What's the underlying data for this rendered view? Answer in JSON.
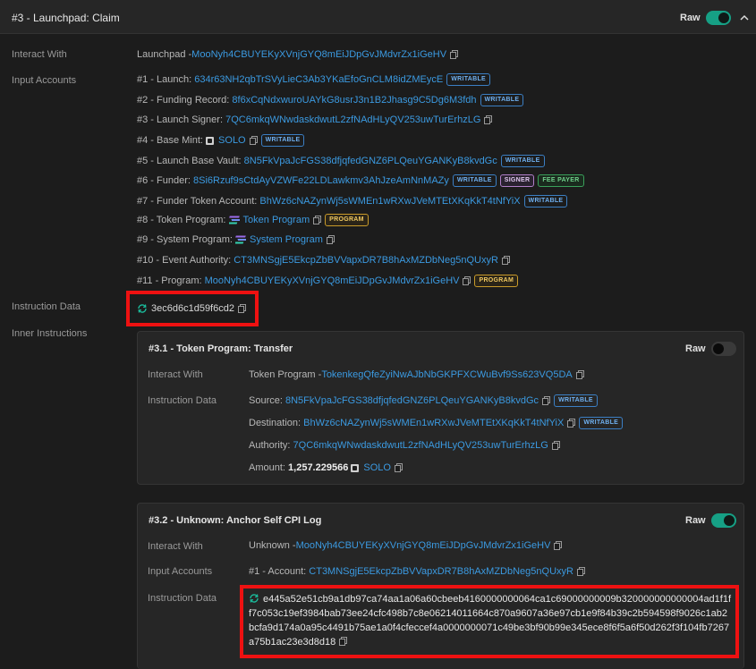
{
  "header": {
    "title": "#3 - Launchpad: Claim",
    "raw_label": "Raw"
  },
  "labels": {
    "interact_with": "Interact With",
    "input_accounts": "Input Accounts",
    "instruction_data": "Instruction Data",
    "inner_instructions": "Inner Instructions"
  },
  "interact": {
    "prefix": "Launchpad - ",
    "address": "MooNyh4CBUYEKyXVnjGYQ8mEiJDpGvJMdvrZx1iGeHV"
  },
  "accounts": [
    {
      "label": "#1 - Launch:",
      "value": "634r63NH2qbTrSVyLieC3Ab3YKaEfoGnCLM8idZMEycE",
      "badges": [
        "WRITABLE"
      ]
    },
    {
      "label": "#2 - Funding Record:",
      "value": "8f6xCqNdxwuroUAYkG8usrJ3n1B2Jhasg9C5Dg6M3fdh",
      "badges": [
        "WRITABLE"
      ]
    },
    {
      "label": "#3 - Launch Signer:",
      "value": "7QC6mkqWNwdaskdwutL2zfNAdHLyQV253uwTurErhzLG",
      "badges": []
    },
    {
      "label": "#4 - Base Mint:",
      "value": "SOLO",
      "badges": [
        "WRITABLE"
      ]
    },
    {
      "label": "#5 - Launch Base Vault:",
      "value": "8N5FkVpaJcFGS38dfjqfedGNZ6PLQeuYGANKyB8kvdGc",
      "badges": [
        "WRITABLE"
      ]
    },
    {
      "label": "#6 - Funder:",
      "value": "8Si6Rzuf9sCtdAyVZWFe22LDLawkmv3AhJzeAmNnMAZy",
      "badges": [
        "WRITABLE",
        "SIGNER",
        "FEE PAYER"
      ]
    },
    {
      "label": "#7 - Funder Token Account:",
      "value": "BhWz6cNAZynWj5sWMEn1wRXwJVeMTEtXKqKkT4tNfYiX",
      "badges": [
        "WRITABLE"
      ]
    },
    {
      "label": "#8 - Token Program:",
      "value": "Token Program",
      "badges": [
        "PROGRAM"
      ]
    },
    {
      "label": "#9 - System Program:",
      "value": "System Program",
      "badges": []
    },
    {
      "label": "#10 - Event Authority:",
      "value": "CT3MNSgjE5EkcpZbBVVapxDR7B8hAxMZDbNeg5nQUxyR",
      "badges": []
    },
    {
      "label": "#11 - Program:",
      "value": "MooNyh4CBUYEKyXVnjGYQ8mEiJDpGvJMdvrZx1iGeHV",
      "badges": [
        "PROGRAM"
      ]
    }
  ],
  "instruction_data": "3ec6d6c1d59f6cd2",
  "inner1": {
    "title": "#3.1 - Token Program: Transfer",
    "raw_label": "Raw",
    "interact_prefix": "Token Program - ",
    "interact_address": "TokenkegQfeZyiNwAJbNbGKPFXCWuBvf9Ss623VQ5DA",
    "source_label": "Source:",
    "source": "8N5FkVpaJcFGS38dfjqfedGNZ6PLQeuYGANKyB8kvdGc",
    "destination_label": "Destination:",
    "destination": "BhWz6cNAZynWj5sWMEn1wRXwJVeMTEtXKqKkT4tNfYiX",
    "authority_label": "Authority:",
    "authority": "7QC6mkqWNwdaskdwutL2zfNAdHLyQV253uwTurErhzLG",
    "amount_label": "Amount:",
    "amount": "1,257.229566",
    "amount_token": "SOLO",
    "writable": "WRITABLE"
  },
  "inner2": {
    "title": "#3.2 - Unknown: Anchor Self CPI Log",
    "raw_label": "Raw",
    "interact_prefix": "Unknown - ",
    "interact_address": "MooNyh4CBUYEKyXVnjGYQ8mEiJDpGvJMdvrZx1iGeHV",
    "account_label": "#1 - Account:",
    "account": "CT3MNSgjE5EkcpZbBVVapxDR7B8hAxMZDbNeg5nQUxyR",
    "data": "e445a52e51cb9a1db97ca74aa1a06a60cbeeb4160000000064ca1c69000000009b320000000000004ad1f1ff7c053c19ef3984bab73ee24cfc498b7c8e06214011664c870a9607a36e97cb1e9f84b39c2b594598f9026c1ab2bcfa9d174a0a95c4491b75ae1a0f4cfeccef4a0000000071c49be3bf90b99e345ece8f6f5a6f50d262f3f104fb7267a75b1ac23e3d8d18"
  },
  "colors": {
    "accent": "#3b9ae1",
    "toggle_on": "#16a085",
    "highlight": "#ee1111"
  }
}
